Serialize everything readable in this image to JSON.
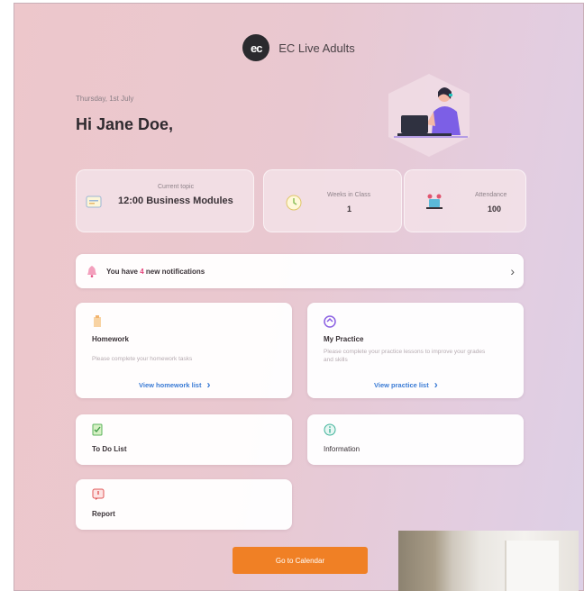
{
  "header": {
    "logo_text": "ec",
    "title": "EC Live Adults"
  },
  "greeting": {
    "date": "Thursday, 1st July",
    "text": "Hi Jane Doe,"
  },
  "stats": [
    {
      "label": "Current topic",
      "value": "12:00 Business Modules",
      "icon": "calendar-icon"
    },
    {
      "label": "Weeks in Class",
      "value": "1",
      "icon": "clock-icon"
    },
    {
      "label": "Attendance",
      "value": "100",
      "icon": "classroom-icon"
    }
  ],
  "notification": {
    "prefix": "You have ",
    "count": "4",
    "suffix": " new notifications",
    "icon": "bell-icon"
  },
  "tiles": {
    "homework": {
      "title": "Homework",
      "desc": "Please complete your homework tasks",
      "link": "View homework list",
      "icon": "homework-icon"
    },
    "practice": {
      "title": "My Practice",
      "desc": "Please complete your practice lessons to improve your grades and skills",
      "link": "View practice list",
      "icon": "practice-icon"
    },
    "todo": {
      "title": "To Do List",
      "icon": "todo-icon"
    },
    "information": {
      "title": "Information",
      "icon": "info-icon"
    },
    "report": {
      "title": "Report",
      "icon": "report-icon"
    }
  },
  "cta": {
    "label": "Go to Calendar"
  },
  "colors": {
    "accent": "#f08025",
    "link": "#3a7bd5",
    "badge": "#e4437b"
  }
}
